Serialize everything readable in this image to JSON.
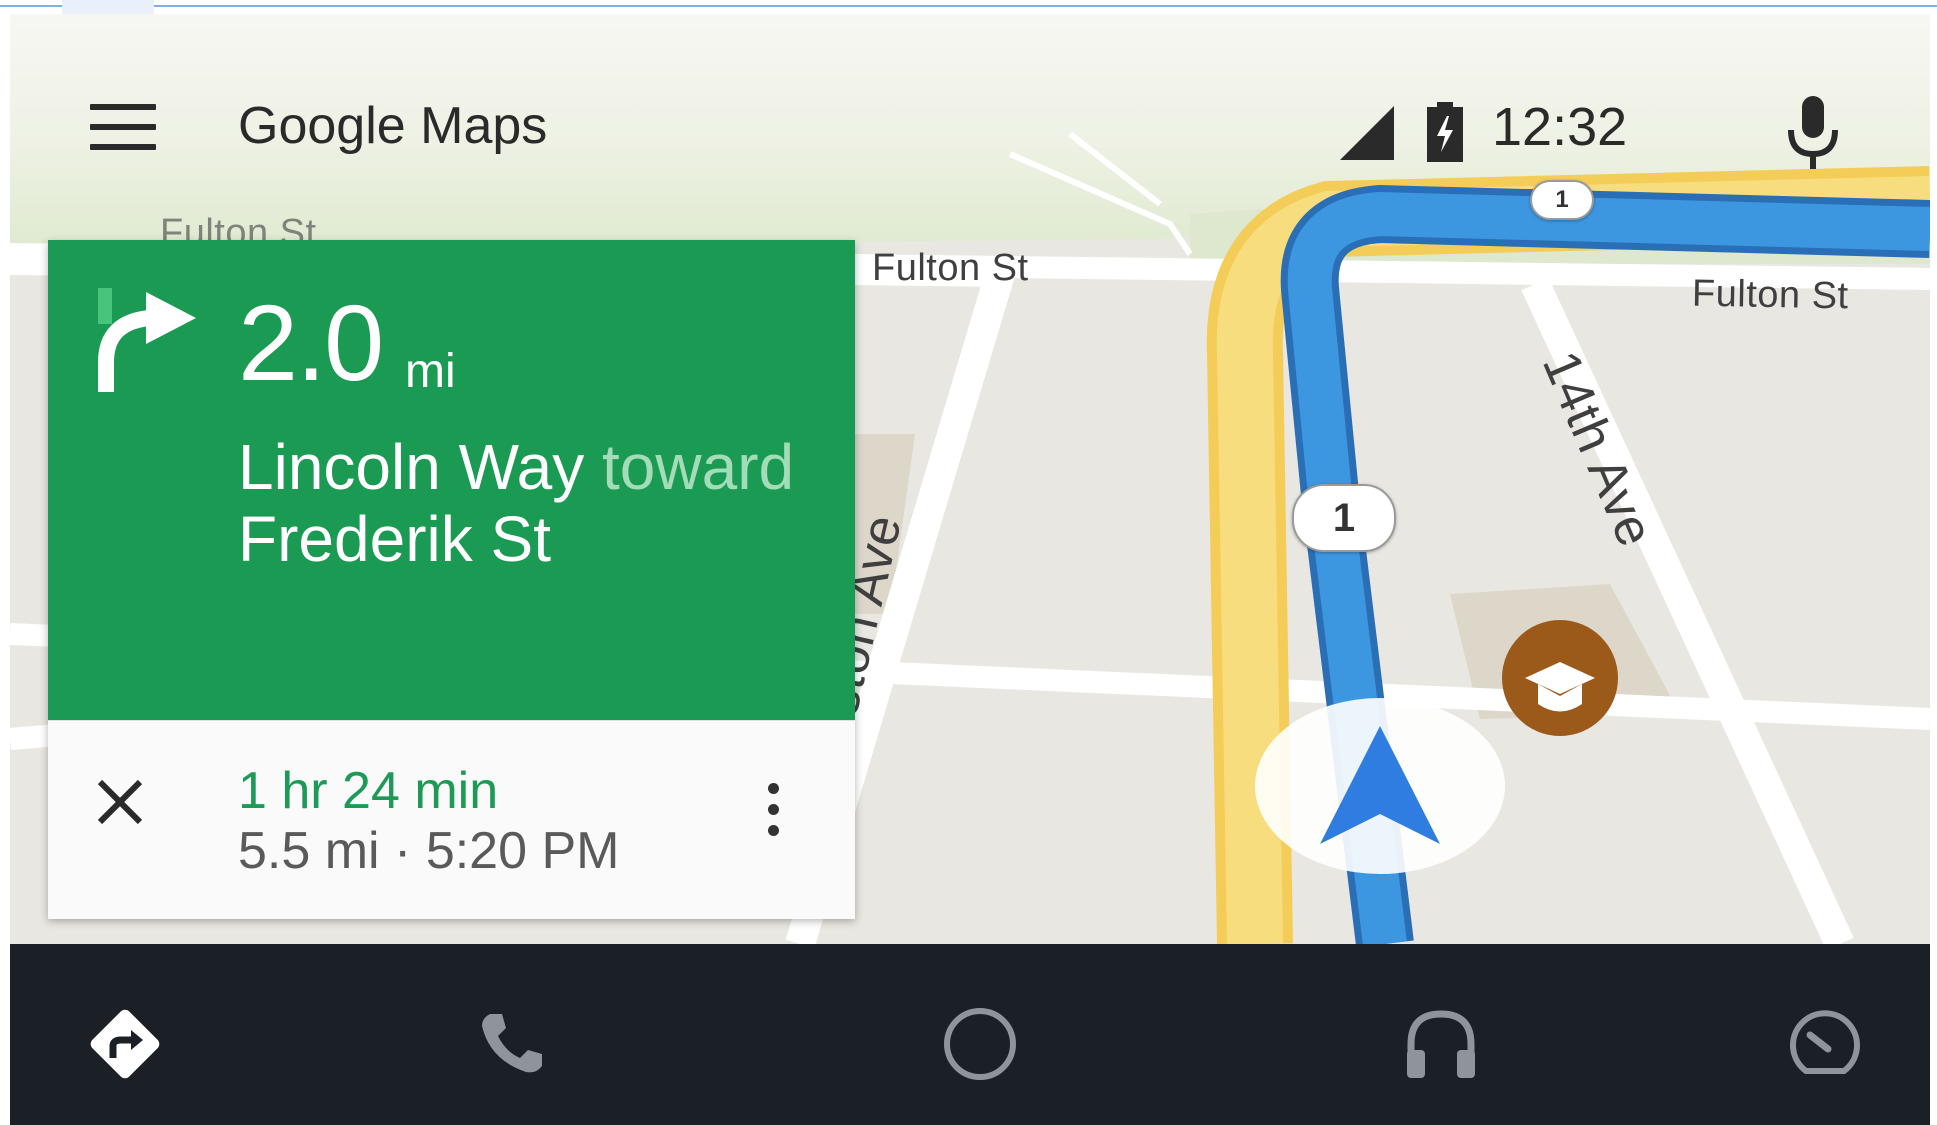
{
  "app": {
    "title": "Google Maps"
  },
  "status": {
    "time": "12:32"
  },
  "map": {
    "streets": {
      "fulton_top_left": "Fulton St",
      "fulton_center": "Fulton St",
      "fulton_right": "Fulton St",
      "avenue_left": "Funston Ave",
      "avenue_right": "14th Ave"
    },
    "route_shields": [
      "1",
      "1"
    ]
  },
  "navigation": {
    "distance_value": "2.0",
    "distance_unit": "mi",
    "street": "Lincoln Way",
    "toward_word": "toward",
    "toward_street": "Frederik St",
    "eta_duration": "1 hr 24 min",
    "eta_details": "5.5 mi · 5:20 PM"
  },
  "colors": {
    "nav_green": "#1a9a52",
    "eta_green": "#1e9a57",
    "route_blue": "#3d97e0",
    "bottom_bar": "#1b1f26"
  },
  "icons": {
    "menu": "menu-icon",
    "signal": "signal-icon",
    "battery": "battery-charging-icon",
    "mic": "microphone-icon",
    "turn": "turn-right-icon",
    "close": "close-icon",
    "more": "more-vert-icon",
    "nav": "navigation-icon",
    "phone": "phone-icon",
    "home": "home-circle-icon",
    "music": "headphones-icon",
    "dashboard": "speedometer-icon",
    "poi": "school-icon"
  }
}
